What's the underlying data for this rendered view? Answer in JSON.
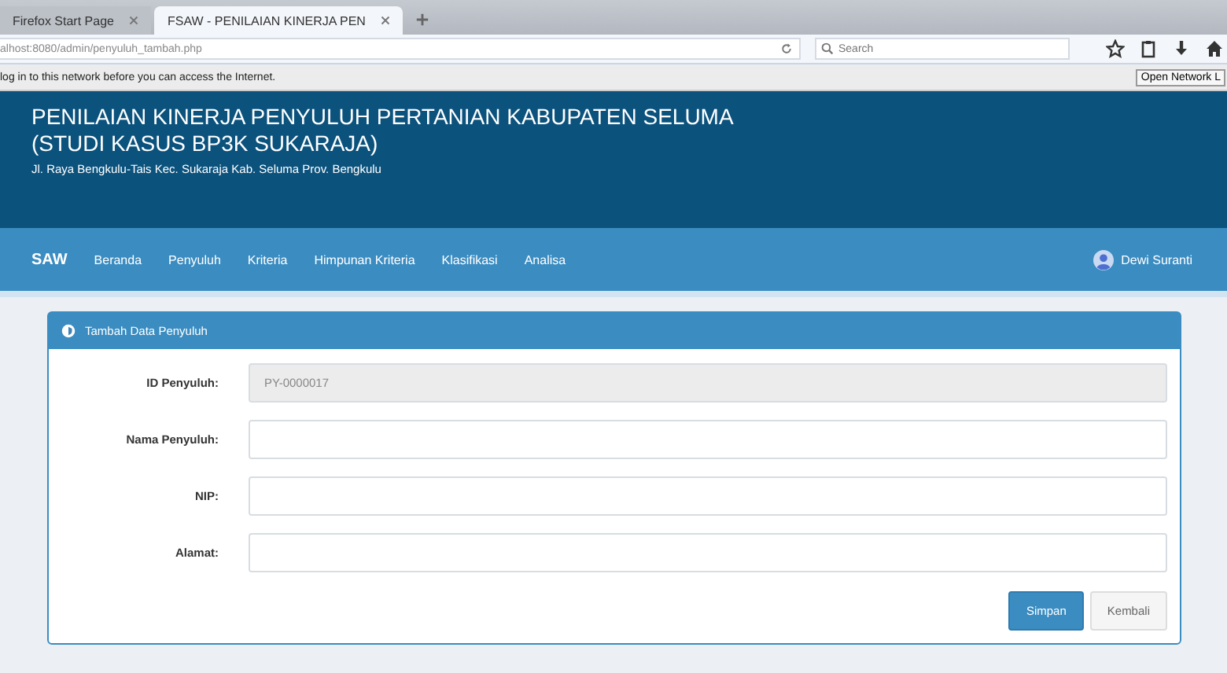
{
  "browser": {
    "tabs": [
      {
        "label": "Firefox Start Page",
        "selected": false
      },
      {
        "label": "FSAW - PENILAIAN KINERJA PEN",
        "selected": true
      }
    ],
    "url": "alhost:8080/admin/penyuluh_tambah.php",
    "search": {
      "placeholder": "Search"
    },
    "notification": "log in to this network before you can access the Internet.",
    "notification_button": "Open Network L"
  },
  "header": {
    "title": "PENILAIAN KINERJA PENYULUH PERTANIAN KABUPATEN SELUMA",
    "subtitle": "(STUDI KASUS BP3K SUKARAJA)",
    "address": "Jl. Raya Bengkulu-Tais Kec. Sukaraja Kab. Seluma Prov. Bengkulu"
  },
  "nav": {
    "brand": "SAW",
    "items": [
      "Beranda",
      "Penyuluh",
      "Kriteria",
      "Himpunan Kriteria",
      "Klasifikasi",
      "Analisa"
    ],
    "user": "Dewi Suranti"
  },
  "panel": {
    "title": "Tambah Data Penyuluh",
    "fields": [
      {
        "label": "ID Penyuluh:",
        "value": "PY-0000017",
        "disabled": true
      },
      {
        "label": "Nama Penyuluh:",
        "disabled": false
      },
      {
        "label": "NIP:",
        "disabled": false
      },
      {
        "label": "Alamat:",
        "disabled": false
      }
    ],
    "buttons": [
      {
        "label": "Simpan",
        "kind": "primary"
      },
      {
        "label": "Kembali",
        "kind": "default"
      }
    ]
  }
}
